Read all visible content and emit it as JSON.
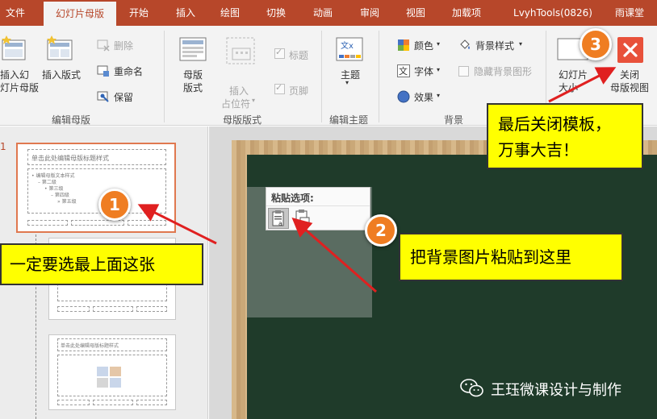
{
  "tabs": [
    "文件",
    "幻灯片母版",
    "开始",
    "插入",
    "绘图",
    "切换",
    "动画",
    "审阅",
    "视图",
    "加载项",
    "LvyhTools(0826)",
    "雨课堂"
  ],
  "active_tab": "幻灯片母版",
  "ribbon": {
    "insert_slide_master": [
      "插入幻",
      "灯片母版"
    ],
    "insert_layout": "插入版式",
    "delete": "删除",
    "rename": "重命名",
    "preserve": "保留",
    "group_edit_master": "编辑母版",
    "master_layout": [
      "母版",
      "版式"
    ],
    "insert_placeholder": [
      "插入",
      "占位符"
    ],
    "title_check": "标题",
    "footer_check": "页脚",
    "group_master_layout": "母版版式",
    "themes": "主题",
    "group_edit_theme": "编辑主题",
    "colors": "颜色",
    "fonts": "字体",
    "effects": "效果",
    "background_styles": "背景样式",
    "hide_bg_graphics": "隐藏背景图形",
    "group_background": "背景",
    "slide_size": [
      "幻灯片",
      "大小"
    ],
    "close_master_view": [
      "关闭",
      "母版视图"
    ]
  },
  "thumbnails": {
    "slide_number": "1",
    "t1_title": "单击此处编辑母版标题样式",
    "t1_body": [
      "• 编辑母版文本样式",
      "– 第二级",
      "• 第三级",
      "– 第四级",
      "» 第五级"
    ],
    "t3_title": "单击此处编辑母版标题样式"
  },
  "paste": {
    "title": "粘贴选项:"
  },
  "callouts": {
    "c1": "一定要选最上面这张",
    "c2": "把背景图片粘贴到这里",
    "c3": [
      "最后关闭模板，",
      "万事大吉！"
    ]
  },
  "badges": [
    "1",
    "2",
    "3"
  ],
  "watermark": "王珏微课设计与制作",
  "colors": {
    "accent": "#b7472a",
    "callout": "#ffff00",
    "badge": "#ef7d22",
    "arrow": "#e02020",
    "close_button": "#e8513a"
  }
}
